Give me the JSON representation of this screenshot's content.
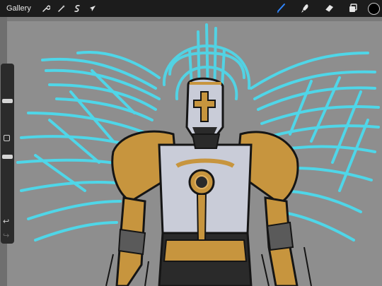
{
  "topbar": {
    "gallery_label": "Gallery",
    "left_tools": [
      "wrench-icon",
      "magic-wand-icon",
      "selection-icon",
      "transform-arrow-icon"
    ],
    "right_tools": [
      "brush-icon",
      "smudge-icon",
      "eraser-icon",
      "layers-icon"
    ],
    "active_tool": "brush-icon",
    "active_color": "#000000",
    "accent": "#2f86ff"
  },
  "sidebar": {
    "size_slider_level": 0.85,
    "opacity_slider_level": 0.7,
    "modify_button": "square-icon",
    "undo": "↩",
    "redo": "↪"
  },
  "artwork": {
    "subject": "angel-knight-illustration",
    "colors": {
      "background": "#8e8e8e",
      "wings": "#4fd6e8",
      "gold": "#c7953e",
      "armor": "#c9ccd8",
      "ink": "#151515"
    }
  }
}
